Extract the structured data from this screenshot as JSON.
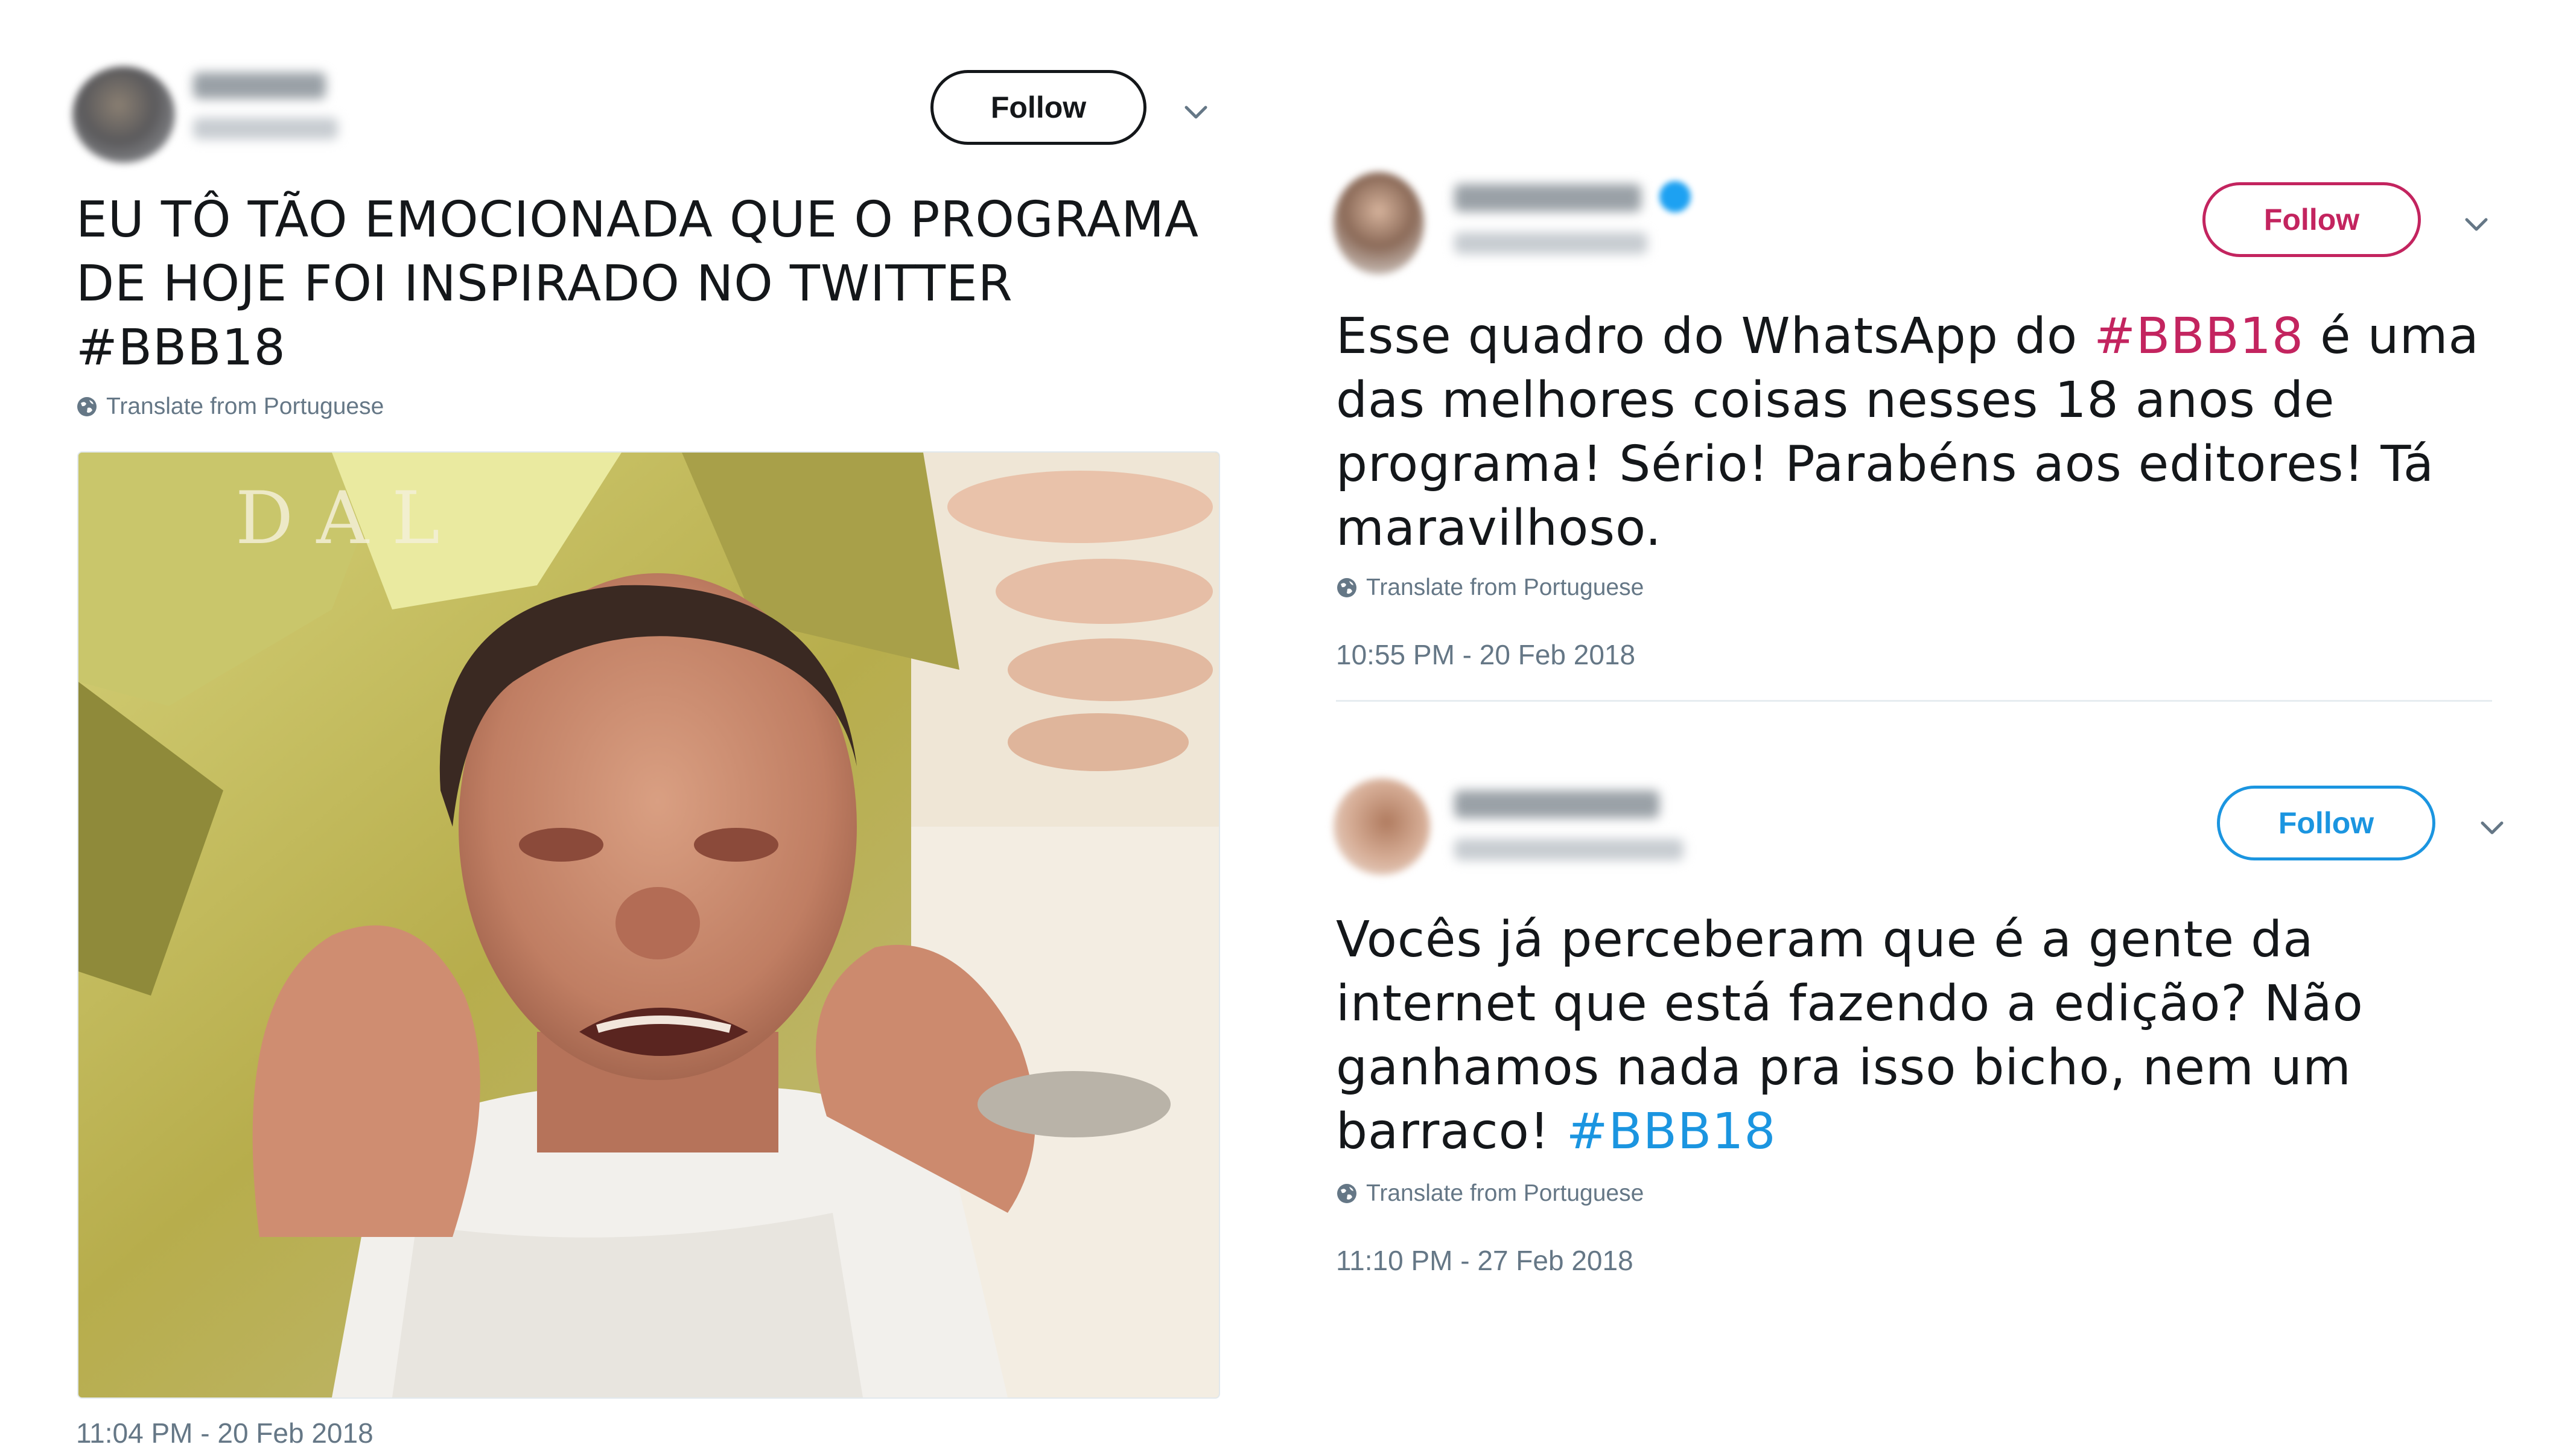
{
  "colors": {
    "link_pink": "#c3245f",
    "link_blue": "#1b95e0",
    "meta_gray": "#657786",
    "follow_pink": "#c3245f",
    "follow_blue": "#1b95e0",
    "follow_dark": "#14171a"
  },
  "tweets": [
    {
      "follow_label": "Follow",
      "text_before": "EU TÔ TÃO EMOCIONADA QUE O PROGRAMA DE HOJE FOI INSPIRADO NO TWITTER ",
      "hashtag": "#BBB18",
      "text_after": "",
      "translate": "Translate from Portuguese",
      "timestamp": "11:04 PM - 20 Feb 2018"
    },
    {
      "follow_label": "Follow",
      "text_before": "Esse quadro do WhatsApp do ",
      "hashtag": "#BBB18",
      "text_after": " é uma das melhores coisas nesses 18 anos de programa! Sério! Parabéns aos editores! Tá maravilhoso.",
      "translate": "Translate from Portuguese",
      "timestamp": "10:55 PM - 20 Feb 2018"
    },
    {
      "follow_label": "Follow",
      "text_before": "Vocês já perceberam que é a gente da internet que está fazendo a edição? Não ganhamos nada pra isso bicho, nem um barraco! ",
      "hashtag": "#BBB18",
      "text_after": "",
      "translate": "Translate from Portuguese",
      "timestamp": "11:10 PM - 27 Feb 2018"
    }
  ],
  "icons": {
    "globe": "globe-icon",
    "chevron": "chevron-down-icon"
  }
}
